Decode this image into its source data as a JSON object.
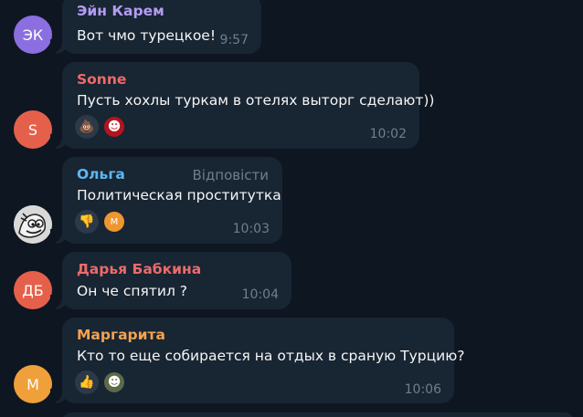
{
  "messages": [
    {
      "sender": "Эйн Карем",
      "text": "Вот чмо турецкое!",
      "time": "9:57",
      "avatar_initials": "ЭК",
      "avatar_color": "#8b6fe0",
      "name_color": "#b49cf3"
    },
    {
      "sender": "Sonne",
      "text": "Пусть хохлы туркам в отелях выторг сделают))",
      "time": "10:02",
      "avatar_initials": "S",
      "avatar_color": "#e5604b",
      "name_color": "#ee6a6a",
      "reactions": [
        {
          "icon": "poop-emoji-icon",
          "glyph": "💩"
        },
        {
          "icon": "red-avatar-reaction-icon",
          "glyph": "☻"
        }
      ]
    },
    {
      "sender": "Ольга",
      "text": "Политическая проституткa",
      "time": "10:03",
      "reply_label": "Відповісти",
      "avatar_initials": "",
      "avatar_color": "#cfcfcf",
      "name_color": "#5fb7f0",
      "reactions": [
        {
          "icon": "thumbs-down-emoji-icon",
          "glyph": "👎"
        },
        {
          "icon": "orange-avatar-reaction-icon",
          "glyph": "M"
        }
      ]
    },
    {
      "sender": "Дарья Бабкина",
      "text": "Он че спятил ?",
      "time": "10:04",
      "avatar_initials": "ДБ",
      "avatar_color": "#e5604b",
      "name_color": "#ee6a6a"
    },
    {
      "sender": "Маргарита",
      "text": "Кто то еще собирается на отдых в сраную Турцию?",
      "time": "10:06",
      "avatar_initials": "М",
      "avatar_color": "#f0a03a",
      "name_color": "#f5a24e",
      "reactions": [
        {
          "icon": "thumbs-up-emoji-icon",
          "glyph": "👍"
        },
        {
          "icon": "green-avatar-reaction-icon",
          "glyph": "☻"
        }
      ]
    }
  ]
}
